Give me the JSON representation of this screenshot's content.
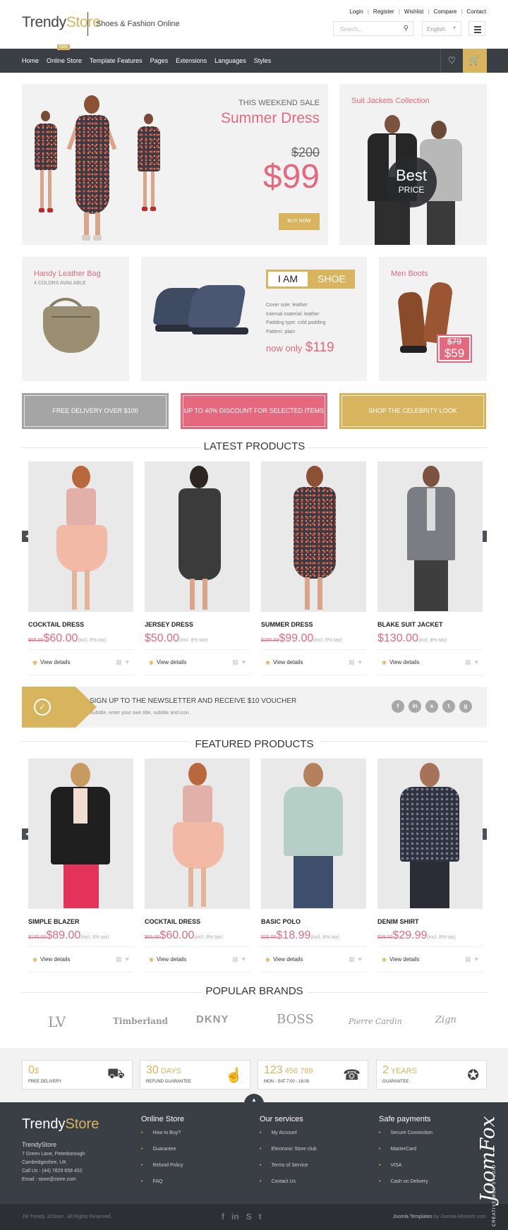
{
  "header": {
    "logo_part1": "Trendy",
    "logo_part2": "Store",
    "tagline": "Shoes & Fashion Online",
    "toplinks": [
      "Login",
      "Register",
      "Wishlist",
      "Compare",
      "Contact"
    ],
    "search_placeholder": "Search...",
    "language": "English"
  },
  "nav": {
    "items": [
      "Home",
      "Online Store",
      "Template Features",
      "Pages",
      "Extensions",
      "Languages",
      "Styles"
    ],
    "new_badge": "NEW"
  },
  "hero": {
    "sale_label": "THIS WEEKEND SALE",
    "title": "Summer Dress",
    "old_price": "$200",
    "new_price": "$99",
    "button": "BUY NOW"
  },
  "suit_banner": {
    "title": "Suit Jackets Collection",
    "badge_line1": "Best",
    "badge_line2": "PRICE"
  },
  "bag_banner": {
    "title": "Handy Leather Bag",
    "subtitle": "4 COLORS AVAILABLE"
  },
  "shoe_banner": {
    "tag_left": "I AM",
    "tag_right": "SHOE",
    "specs": [
      "Cover sole: leather",
      "Internal material: leather",
      "Padding type: cold padding",
      "Pattern: plain"
    ],
    "now_only": "now only",
    "price": "$119"
  },
  "boots_banner": {
    "title": "Men Boots",
    "old_price": "$79",
    "new_price": "$59"
  },
  "promos": [
    "FREE DELIVERY OVER $100",
    "UP TO 40% DISCOUNT FOR SELECTED ITEMS",
    "SHOP THE CELEBRITY LOOK"
  ],
  "latest": {
    "title": "LATEST PRODUCTS",
    "products": [
      {
        "name": "COCKTAIL DRESS",
        "old": "$65.00",
        "price": "$60.00",
        "tax": "(incl. 8% tax)",
        "view": "View details"
      },
      {
        "name": "JERSEY DRESS",
        "old": "",
        "price": "$50.00",
        "tax": "(incl. 8% tax)",
        "view": "View details"
      },
      {
        "name": "SUMMER DRESS",
        "old": "$200.00",
        "price": "$99.00",
        "tax": "(incl. 8% tax)",
        "view": "View details"
      },
      {
        "name": "BLAKE SUIT JACKET",
        "old": "",
        "price": "$130.00",
        "tax": "(incl. 8% tax)",
        "view": "View details"
      }
    ]
  },
  "newsletter": {
    "title": "SIGN UP TO THE NEWSLETTER AND RECEIVE $10 VOUCHER",
    "subtitle": "Subtitle, enter your own title, subtitle and icon",
    "social": [
      "f",
      "in",
      "s",
      "t",
      "g"
    ]
  },
  "featured": {
    "title": "FEATURED PRODUCTS",
    "products": [
      {
        "name": "SIMPLE BLAZER",
        "old": "$130.00",
        "price": "$89.00",
        "tax": "(incl. 8% tax)",
        "view": "View details"
      },
      {
        "name": "COCKTAIL DRESS",
        "old": "$65.00",
        "price": "$60.00",
        "tax": "(incl. 8% tax)",
        "view": "View details"
      },
      {
        "name": "BASIC POLO",
        "old": "$25.00",
        "price": "$18.99",
        "tax": "(incl. 8% tax)",
        "view": "View details"
      },
      {
        "name": "DENIM SHIRT",
        "old": "$38.00",
        "price": "$29.99",
        "tax": "(incl. 8% tax)",
        "view": "View details"
      }
    ]
  },
  "brands": {
    "title": "POPULAR BRANDS",
    "items": [
      "LV",
      "Timberland",
      "DKNY",
      "BOSS",
      "Pierre Cardin",
      "Zign"
    ]
  },
  "services": [
    {
      "big": "0",
      "unit": "$",
      "label": "FREE DELIVERY",
      "icon": "truck-icon"
    },
    {
      "big": "30",
      "unit": " DAYS",
      "label": "REFUND GUARANTEE",
      "icon": "thumbs-up-icon"
    },
    {
      "big": "123",
      "unit": " 456 789",
      "label": "MON - SAT 7:00 - 18:00",
      "icon": "headset-icon"
    },
    {
      "big": "2",
      "unit": " YEARS",
      "label": "GUARANTEE",
      "icon": "star-badge-icon"
    }
  ],
  "footer": {
    "logo_part1": "Trendy",
    "logo_part2": "Store",
    "company": "TrendyStore",
    "address1": "7 Green Lane, Peterborough",
    "address2": "Cambridgeshire, UK",
    "phone": "Call Us : (44) 7829 658 452",
    "email": "Email : store@store.com",
    "col1_title": "Online Store",
    "col1": [
      "How to Buy?",
      "Guarantee",
      "Refund Policy",
      "FAQ"
    ],
    "col2_title": "Our services",
    "col2": [
      "My Account",
      "Electronic Store club",
      "Terms of Service",
      "Contact Us"
    ],
    "col3_title": "Safe payments",
    "col3": [
      "Secure Connection",
      "MasterCard",
      "VISA",
      "Cash on Delivery"
    ]
  },
  "copyright": {
    "left": "JM Trendy J2Store . All Rights Reserved.",
    "right_bold": "Joomla Templates",
    "right_rest": " by Joomla-Monster.com"
  },
  "watermark": {
    "brand": "JoomFox",
    "sub": "CREATIVE WEB STUDIO"
  },
  "colors": {
    "accent": "#d9b45f",
    "pink": "#e5697e",
    "dark": "#3a3f45"
  }
}
